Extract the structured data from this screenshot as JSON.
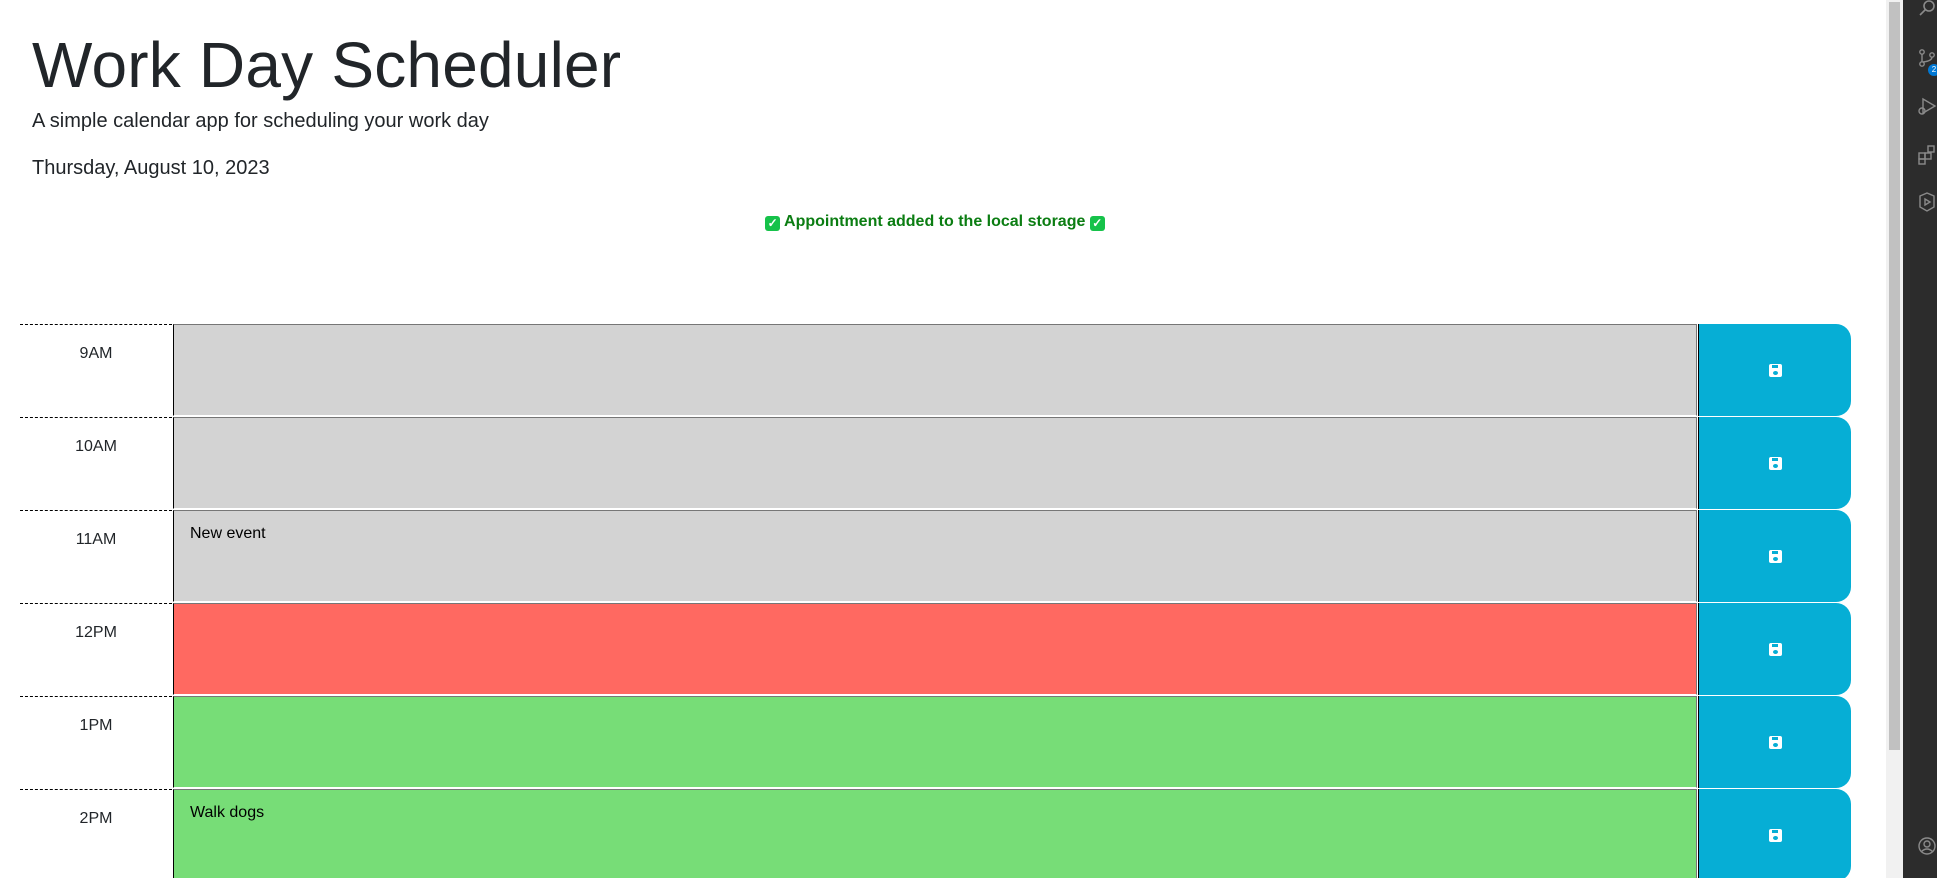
{
  "header": {
    "title": "Work Day Scheduler",
    "subtitle": "A simple calendar app for scheduling your work day",
    "current_day": "Thursday, August 10, 2023"
  },
  "notice": {
    "text": "Appointment added to the local storage",
    "icon": "check-square-icon"
  },
  "time_blocks": [
    {
      "hour": "9AM",
      "text": "",
      "status": "past"
    },
    {
      "hour": "10AM",
      "text": "",
      "status": "past"
    },
    {
      "hour": "11AM",
      "text": "New event",
      "status": "past"
    },
    {
      "hour": "12PM",
      "text": "",
      "status": "present"
    },
    {
      "hour": "1PM",
      "text": "",
      "status": "future"
    },
    {
      "hour": "2PM",
      "text": "Walk dogs",
      "status": "future"
    }
  ],
  "save_icon": "floppy-disk-icon",
  "colors": {
    "past": "#d3d3d3",
    "present": "#ff6961",
    "future": "#77dd77",
    "save_button": "#06aed5",
    "notice_text": "#0b7d12",
    "notice_check": "#16c24a"
  },
  "activity_bar": {
    "icons": [
      "search-icon",
      "source-control-icon",
      "run-debug-icon",
      "extensions-icon",
      "remote-explorer-icon",
      "account-icon"
    ],
    "badge": "2"
  }
}
